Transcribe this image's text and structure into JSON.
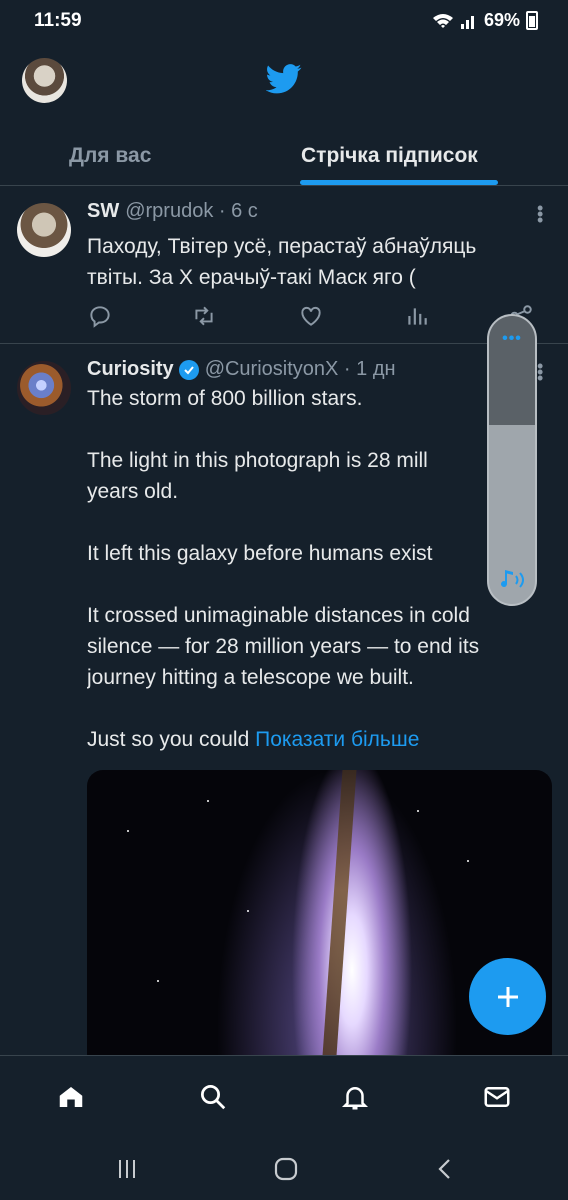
{
  "status_bar": {
    "time": "11:59",
    "battery": "69%"
  },
  "tabs": [
    {
      "label": "Для вас"
    },
    {
      "label": "Стрічка підписок"
    }
  ],
  "tweets": [
    {
      "name": "SW",
      "handle": "@rprudok · 6 с",
      "text": "Паходу, Твітер усё, перастаў абнаўляць\nтвіты. За X ерачыў-такі Маск яго ("
    },
    {
      "name": "Curiosity",
      "handle": "@CuriosityonX · 1 дн",
      "text": "The storm of 800 billion stars.\n\nThe light in this photograph is 28 mill\nyears old.\n\nIt left this galaxy before humans exist\n\nIt crossed unimaginable distances in cold\nsilence — for 28 million years — to end its\njourney hitting a telescope we built.\n\nJust so you could ",
      "show_more": "Показати більше"
    }
  ],
  "volume_panel": {
    "dots": "•••",
    "level": 0.62
  },
  "colors": {
    "background": "#15202b",
    "accent": "#1d9bf0",
    "text": "#e7e9ea",
    "muted": "#8b98a5"
  },
  "icons": [
    "twitter-bird-icon",
    "reply-icon",
    "retweet-icon",
    "like-icon",
    "views-icon",
    "share-icon",
    "home-icon",
    "search-icon",
    "notifications-icon",
    "messages-icon",
    "compose-icon"
  ]
}
